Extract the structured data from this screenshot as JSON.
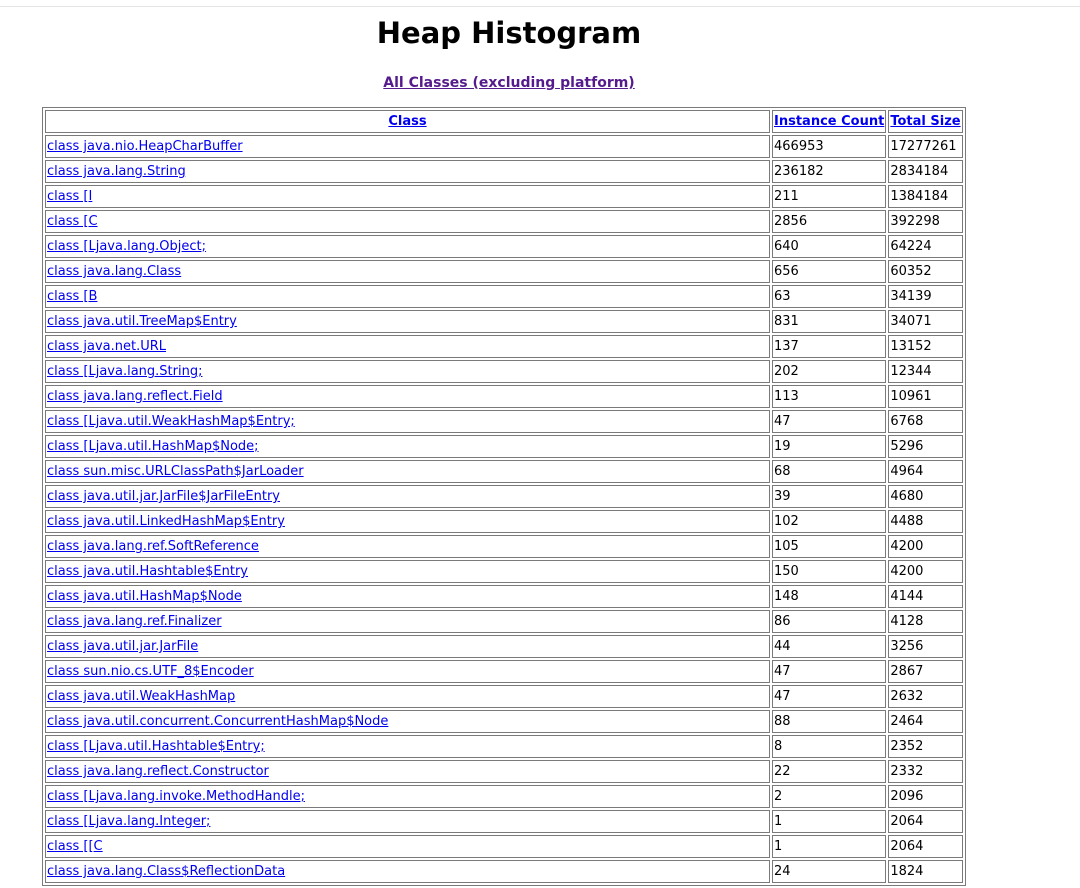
{
  "page": {
    "title": "Heap Histogram",
    "subtitle_link": "All Classes (excluding platform)"
  },
  "table": {
    "headers": [
      "Class",
      "Instance Count",
      "Total Size"
    ],
    "rows": [
      {
        "cls": "class java.nio.HeapCharBuffer",
        "count": "466953",
        "size": "17277261"
      },
      {
        "cls": "class java.lang.String",
        "count": "236182",
        "size": "2834184"
      },
      {
        "cls": "class [I",
        "count": "211",
        "size": "1384184"
      },
      {
        "cls": "class [C",
        "count": "2856",
        "size": "392298"
      },
      {
        "cls": "class [Ljava.lang.Object;",
        "count": "640",
        "size": "64224"
      },
      {
        "cls": "class java.lang.Class",
        "count": "656",
        "size": "60352"
      },
      {
        "cls": "class [B",
        "count": "63",
        "size": "34139"
      },
      {
        "cls": "class java.util.TreeMap$Entry",
        "count": "831",
        "size": "34071"
      },
      {
        "cls": "class java.net.URL",
        "count": "137",
        "size": "13152"
      },
      {
        "cls": "class [Ljava.lang.String;",
        "count": "202",
        "size": "12344"
      },
      {
        "cls": "class java.lang.reflect.Field",
        "count": "113",
        "size": "10961"
      },
      {
        "cls": "class [Ljava.util.WeakHashMap$Entry;",
        "count": "47",
        "size": "6768"
      },
      {
        "cls": "class [Ljava.util.HashMap$Node;",
        "count": "19",
        "size": "5296"
      },
      {
        "cls": "class sun.misc.URLClassPath$JarLoader",
        "count": "68",
        "size": "4964"
      },
      {
        "cls": "class java.util.jar.JarFile$JarFileEntry",
        "count": "39",
        "size": "4680"
      },
      {
        "cls": "class java.util.LinkedHashMap$Entry",
        "count": "102",
        "size": "4488"
      },
      {
        "cls": "class java.lang.ref.SoftReference",
        "count": "105",
        "size": "4200"
      },
      {
        "cls": "class java.util.Hashtable$Entry",
        "count": "150",
        "size": "4200"
      },
      {
        "cls": "class java.util.HashMap$Node",
        "count": "148",
        "size": "4144"
      },
      {
        "cls": "class java.lang.ref.Finalizer",
        "count": "86",
        "size": "4128"
      },
      {
        "cls": "class java.util.jar.JarFile",
        "count": "44",
        "size": "3256"
      },
      {
        "cls": "class sun.nio.cs.UTF_8$Encoder",
        "count": "47",
        "size": "2867"
      },
      {
        "cls": "class java.util.WeakHashMap",
        "count": "47",
        "size": "2632"
      },
      {
        "cls": "class java.util.concurrent.ConcurrentHashMap$Node",
        "count": "88",
        "size": "2464"
      },
      {
        "cls": "class [Ljava.util.Hashtable$Entry;",
        "count": "8",
        "size": "2352"
      },
      {
        "cls": "class java.lang.reflect.Constructor",
        "count": "22",
        "size": "2332"
      },
      {
        "cls": "class [Ljava.lang.invoke.MethodHandle;",
        "count": "2",
        "size": "2096"
      },
      {
        "cls": "class [Ljava.lang.Integer;",
        "count": "1",
        "size": "2064"
      },
      {
        "cls": "class [[C",
        "count": "1",
        "size": "2064"
      },
      {
        "cls": "class java.lang.Class$ReflectionData",
        "count": "24",
        "size": "1824"
      }
    ]
  }
}
